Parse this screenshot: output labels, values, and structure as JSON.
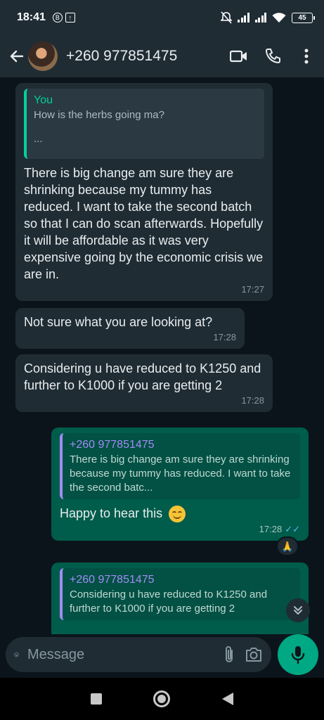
{
  "status_bar": {
    "time": "18:41",
    "battery": "45"
  },
  "header": {
    "contact": "+260 977851475"
  },
  "messages": [
    {
      "quote_title": "You",
      "quote_text": "How is the herbs going ma?",
      "quote_extra": "...",
      "text": "There is big change am sure they are shrinking because my tummy has reduced. I want to take the second batch so that I can do scan afterwards. Hopefully it will be affordable as it was very expensive going by the economic crisis we are in.",
      "time": "17:27"
    },
    {
      "text": "Not sure what you are looking at?",
      "time": "17:28"
    },
    {
      "text": "Considering u have reduced to K1250 and further to K1000 if you are getting 2",
      "time": "17:28"
    },
    {
      "quote_title": "+260 977851475",
      "quote_text": "There is big change am sure they are shrinking because my tummy has reduced. I want to take the second batc...",
      "text": "Happy to hear this",
      "time": "17:28",
      "reaction": "🙏"
    },
    {
      "quote_title": "+260 977851475",
      "quote_text": "Considering u have reduced to K1250 and further to K1000 if you are getting 2"
    }
  ],
  "composer": {
    "placeholder": "Message"
  },
  "colors": {
    "accent": "#00a884",
    "outgoing": "#005c4b",
    "incoming": "#1f2c34",
    "read_ticks": "#53bdeb"
  }
}
